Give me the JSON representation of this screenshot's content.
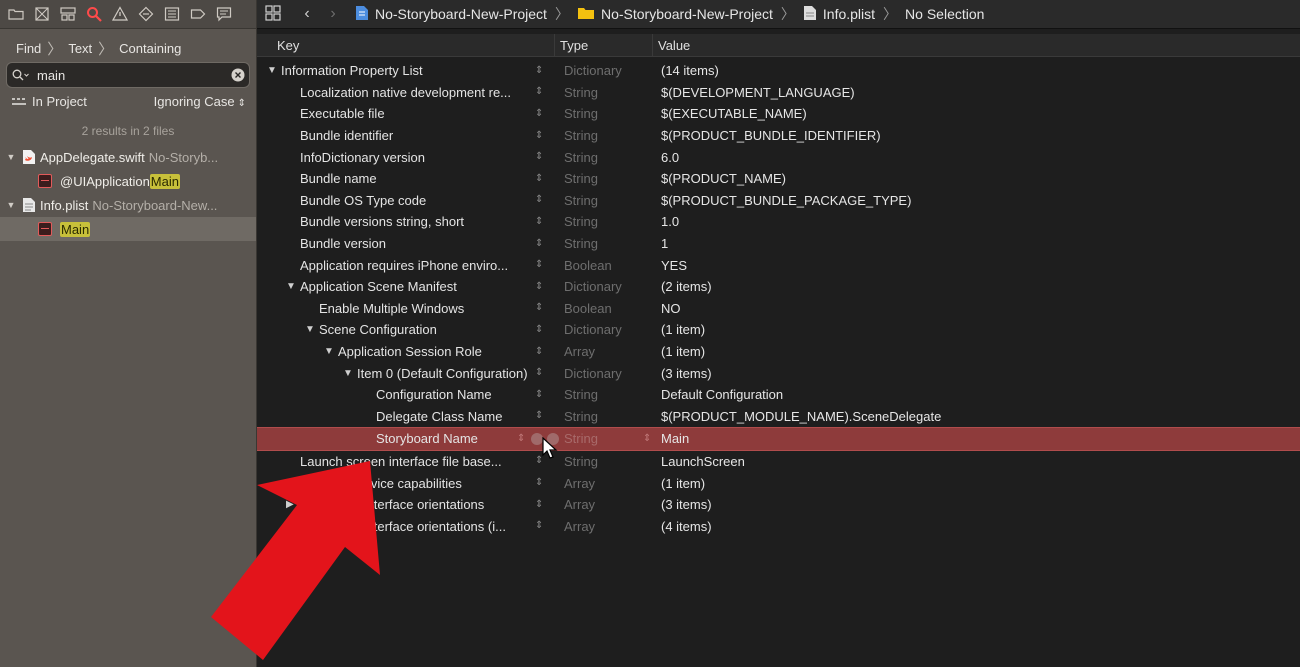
{
  "sidebar": {
    "toolbar_icons": [
      "folder-icon",
      "source-control-icon",
      "hierarchy-icon",
      "find-icon",
      "warning-icon",
      "breakpoint-icon",
      "list-icon",
      "tag-icon",
      "comment-icon"
    ],
    "find_path": [
      "Find",
      "Text",
      "Containing"
    ],
    "search": {
      "value": "main",
      "placeholder": ""
    },
    "scope": "In Project",
    "case": "Ignoring Case",
    "results_summary": "2 results in 2 files",
    "results": [
      {
        "file": "AppDelegate.swift",
        "path": "No-Storyb...",
        "matches": [
          {
            "prefix": "@UIApplication",
            "match": "Main"
          }
        ]
      },
      {
        "file": "Info.plist",
        "path": "No-Storyboard-New...",
        "matches": [
          {
            "prefix": "",
            "match": "Main"
          }
        ]
      }
    ]
  },
  "editor": {
    "breadcrumb": [
      "No-Storyboard-New-Project",
      "No-Storyboard-New-Project",
      "Info.plist",
      "No Selection"
    ],
    "columns": {
      "key": "Key",
      "type": "Type",
      "value": "Value"
    },
    "rows": [
      {
        "key": "Information Property List",
        "type": "Dictionary",
        "value": "(14 items)",
        "indent": 0,
        "disclosure": "▼"
      },
      {
        "key": "Localization native development re...",
        "type": "String",
        "value": "$(DEVELOPMENT_LANGUAGE)",
        "indent": 1,
        "disclosure": ""
      },
      {
        "key": "Executable file",
        "type": "String",
        "value": "$(EXECUTABLE_NAME)",
        "indent": 1,
        "disclosure": ""
      },
      {
        "key": "Bundle identifier",
        "type": "String",
        "value": "$(PRODUCT_BUNDLE_IDENTIFIER)",
        "indent": 1,
        "disclosure": ""
      },
      {
        "key": "InfoDictionary version",
        "type": "String",
        "value": "6.0",
        "indent": 1,
        "disclosure": ""
      },
      {
        "key": "Bundle name",
        "type": "String",
        "value": "$(PRODUCT_NAME)",
        "indent": 1,
        "disclosure": ""
      },
      {
        "key": "Bundle OS Type code",
        "type": "String",
        "value": "$(PRODUCT_BUNDLE_PACKAGE_TYPE)",
        "indent": 1,
        "disclosure": ""
      },
      {
        "key": "Bundle versions string, short",
        "type": "String",
        "value": "1.0",
        "indent": 1,
        "disclosure": ""
      },
      {
        "key": "Bundle version",
        "type": "String",
        "value": "1",
        "indent": 1,
        "disclosure": ""
      },
      {
        "key": "Application requires iPhone enviro...",
        "type": "Boolean",
        "value": "YES",
        "indent": 1,
        "disclosure": ""
      },
      {
        "key": "Application Scene Manifest",
        "type": "Dictionary",
        "value": "(2 items)",
        "indent": 1,
        "disclosure": "▼"
      },
      {
        "key": "Enable Multiple Windows",
        "type": "Boolean",
        "value": "NO",
        "indent": 2,
        "disclosure": ""
      },
      {
        "key": "Scene Configuration",
        "type": "Dictionary",
        "value": "(1 item)",
        "indent": 2,
        "disclosure": "▼"
      },
      {
        "key": "Application Session Role",
        "type": "Array",
        "value": "(1 item)",
        "indent": 3,
        "disclosure": "▼"
      },
      {
        "key": "Item 0 (Default Configuration)",
        "type": "Dictionary",
        "value": "(3 items)",
        "indent": 4,
        "disclosure": "▼"
      },
      {
        "key": "Configuration Name",
        "type": "String",
        "value": "Default Configuration",
        "indent": 5,
        "disclosure": ""
      },
      {
        "key": "Delegate Class Name",
        "type": "String",
        "value": "$(PRODUCT_MODULE_NAME).SceneDelegate",
        "indent": 5,
        "disclosure": ""
      },
      {
        "key": "Storyboard Name",
        "type": "String",
        "value": "Main",
        "indent": 5,
        "disclosure": "",
        "selected": true
      },
      {
        "key": "Launch screen interface file base...",
        "type": "String",
        "value": "LaunchScreen",
        "indent": 1,
        "disclosure": ""
      },
      {
        "key": "Required device capabilities",
        "type": "Array",
        "value": "(1 item)",
        "indent": 1,
        "disclosure": "▶"
      },
      {
        "key": "Supported interface orientations",
        "type": "Array",
        "value": "(3 items)",
        "indent": 1,
        "disclosure": "▶"
      },
      {
        "key": "Supported interface orientations (i...",
        "type": "Array",
        "value": "(4 items)",
        "indent": 1,
        "disclosure": "▶"
      }
    ]
  },
  "colors": {
    "selection": "#8e3b3b",
    "highlight": "#c7c03a",
    "arrow": "#e3141b",
    "sidebar": "#5a5550"
  }
}
